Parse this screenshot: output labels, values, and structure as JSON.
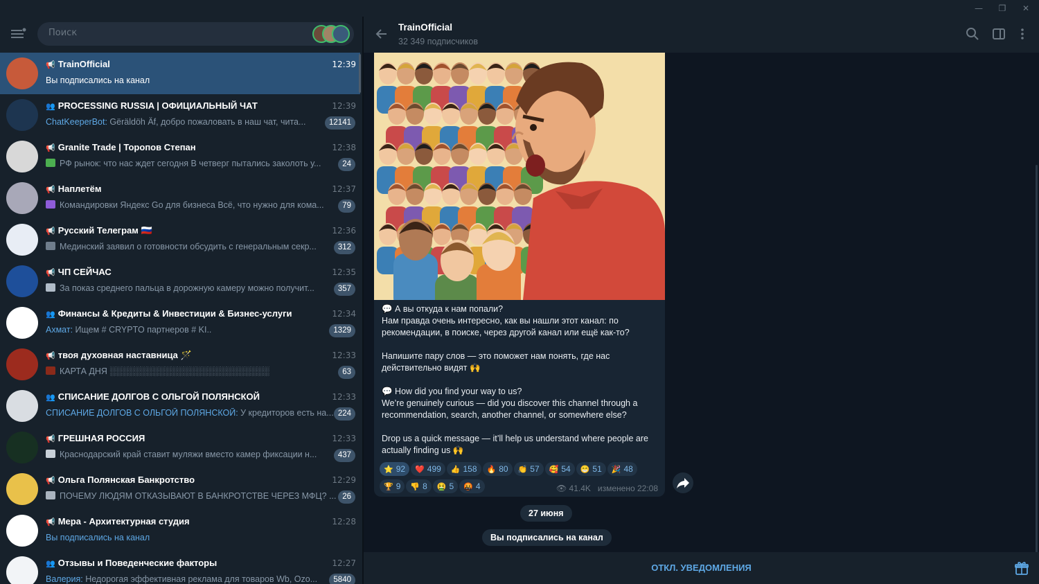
{
  "window": {
    "minimize": "—",
    "maximize": "❐",
    "close": "✕"
  },
  "sidebar": {
    "search_placeholder": "Поиск",
    "chats": [
      {
        "title": "TrainOfficial",
        "type": "channel",
        "time": "12:39",
        "preview": "Вы подписались на канал",
        "sender": "",
        "badge": "",
        "active": true,
        "avatar_color": "#c75a3a"
      },
      {
        "title": "PROCESSING RUSSIA | ОФИЦИАЛЬНЫЙ ЧАТ",
        "type": "group",
        "time": "12:39",
        "sender": "ChatKeeperBot:",
        "preview": " Gëräldöh Äf, добро пожаловать в наш чат, чита...",
        "badge": "12141",
        "avatar_color": "#1d3550"
      },
      {
        "title": "Granite Trade | Торопов Степан",
        "type": "channel",
        "time": "12:38",
        "sender": "",
        "preview": "РФ рынок: что нас ждет сегодня  В четверг пытались заколоть у...",
        "badge": "24",
        "avatar_color": "#d8d8d8",
        "thumb": "#4caf50"
      },
      {
        "title": "Наплетём",
        "type": "channel",
        "time": "12:37",
        "sender": "",
        "preview": "Командировки Яндекс Go для бизнеса  Всё, что нужно для кома...",
        "badge": "79",
        "avatar_color": "#a8a8b8",
        "thumb": "#8e5cd9"
      },
      {
        "title": "Русский Телеграм 🇷🇺",
        "type": "channel",
        "time": "12:36",
        "sender": "",
        "preview": "Мединский заявил о готовности обсудить с генеральным секр...",
        "badge": "312",
        "avatar_color": "#e8edf5",
        "thumb": "#6f7d8c"
      },
      {
        "title": "ЧП СЕЙЧАС",
        "type": "channel",
        "time": "12:35",
        "sender": "",
        "preview": "За показ среднего пальца в дорожную камеру можно получит...",
        "badge": "357",
        "avatar_color": "#1e4f9a",
        "thumb": "#b0bcc8"
      },
      {
        "title": "Финансы & Кредиты & Инвестиции & Бизнес-услуги",
        "type": "group",
        "time": "12:34",
        "sender": "Ахмат:",
        "preview": " Ищем   # CRYPTO  партнеров  # KI..",
        "badge": "1329",
        "avatar_color": "#ffffff"
      },
      {
        "title": "твоя духовная наставница 🪄",
        "type": "channel",
        "time": "12:33",
        "sender": "",
        "preview": "КАРТА ДНЯ  ░░░░░░░░░░░░░░░░░░░░░░░░░░",
        "badge": "63",
        "avatar_color": "#9c2b1e",
        "thumb": "#8a2a1a"
      },
      {
        "title": "СПИСАНИЕ ДОЛГОВ С ОЛЬГОЙ ПОЛЯНСКОЙ",
        "type": "group",
        "time": "12:33",
        "sender": "СПИСАНИЕ ДОЛГОВ С ОЛЬГОЙ ПОЛЯНСКОЙ:",
        "preview": " У кредиторов есть на...",
        "badge": "224",
        "avatar_color": "#d9dde2"
      },
      {
        "title": "ГРЕШНАЯ РОССИЯ",
        "type": "channel",
        "time": "12:33",
        "sender": "",
        "preview": "Краснодарский край ставит муляжи вместо камер фиксации н...",
        "badge": "437",
        "avatar_color": "#173022",
        "thumb": "#c8d0d8"
      },
      {
        "title": "Ольга Полянская Банкротство",
        "type": "channel",
        "time": "12:29",
        "sender": "",
        "preview": "ПОЧЕМУ ЛЮДЯМ ОТКАЗЫВАЮТ В БАНКРОТСТВЕ ЧЕРЕЗ МФЦ?  ...",
        "badge": "26",
        "avatar_color": "#e9c14a",
        "thumb": "#aab4bf"
      },
      {
        "title": "Мера - Архитектурная студия",
        "type": "channel",
        "time": "12:28",
        "sender": "",
        "preview": "Вы подписались на канал",
        "badge": "",
        "avatar_color": "#ffffff",
        "preview_blue": true
      },
      {
        "title": "Отзывы и Поведенческие факторы",
        "type": "group",
        "time": "12:27",
        "sender": "Валерия:",
        "preview": " Недорогая эффективная реклама для товаров Wb, Ozo...",
        "badge": "5840",
        "avatar_color": "#f2f4f7"
      }
    ]
  },
  "header": {
    "title": "TrainOfficial",
    "subtitle": "32 349 подписчиков"
  },
  "message": {
    "text": [
      "💬 А вы откуда к нам попали?\nНам правда очень интересно, как вы нашли этот канал: по рекомендации, в поиске, через другой канал или ещё как-то?",
      "Напишите пару слов — это поможет нам понять, где нас действительно видят 🙌",
      "💬 How did you find your way to us?\nWe’re genuinely curious — did you discover this channel through a recommendation, search, another channel, or somewhere else?",
      "Drop us a quick message — it’ll help us understand where people are actually finding us 🙌"
    ],
    "reactions": [
      {
        "emoji": "⭐",
        "count": "92",
        "own": true
      },
      {
        "emoji": "❤️",
        "count": "499"
      },
      {
        "emoji": "👍",
        "count": "158"
      },
      {
        "emoji": "🔥",
        "count": "80"
      },
      {
        "emoji": "👏",
        "count": "57"
      },
      {
        "emoji": "🥰",
        "count": "54"
      },
      {
        "emoji": "😁",
        "count": "51"
      },
      {
        "emoji": "🎉",
        "count": "48"
      },
      {
        "emoji": "🏆",
        "count": "9"
      },
      {
        "emoji": "👎",
        "count": "8"
      },
      {
        "emoji": "🤮",
        "count": "5"
      },
      {
        "emoji": "🤬",
        "count": "4"
      }
    ],
    "views": "41.4K",
    "edited": "изменено 22:08"
  },
  "date_pill": "27 июня",
  "service_msg": "Вы подписались на канал",
  "bottom": {
    "mute_label": "ОТКЛ. УВЕДОМЛЕНИЯ"
  },
  "colors": {
    "accent": "#5ea8e5",
    "active": "#2b5278",
    "bg": "#0e1621",
    "panel": "#17212b"
  }
}
